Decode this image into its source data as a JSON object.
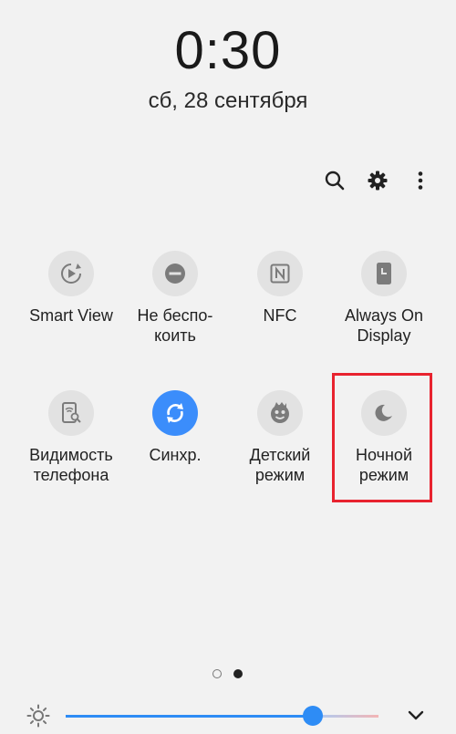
{
  "status": {
    "time": "0:30",
    "date": "сб, 28 сентября"
  },
  "toolbar": {
    "search_icon": "search-icon",
    "settings_icon": "gear-icon",
    "more_icon": "more-vertical-icon"
  },
  "tiles": [
    {
      "label": "Smart View",
      "icon": "smart-view-icon",
      "active": false
    },
    {
      "label": "Не беспо-\nкоить",
      "icon": "do-not-disturb-icon",
      "active": false
    },
    {
      "label": "NFC",
      "icon": "nfc-icon",
      "active": false
    },
    {
      "label": "Always On\nDisplay",
      "icon": "always-on-display-icon",
      "active": false
    },
    {
      "label": "Видимость\nтелефона",
      "icon": "phone-visibility-icon",
      "active": false
    },
    {
      "label": "Синхр.",
      "icon": "sync-icon",
      "active": true
    },
    {
      "label": "Детский\nрежим",
      "icon": "kids-mode-icon",
      "active": false
    },
    {
      "label": "Ночной\nрежим",
      "icon": "moon-icon",
      "active": false
    }
  ],
  "pagination": {
    "pages": 2,
    "current": 2
  },
  "brightness": {
    "level": 0.79,
    "icon": "brightness-icon"
  },
  "colors": {
    "accent": "#3b8dfb",
    "highlight": "#e8232f",
    "background": "#f2f2f2"
  }
}
